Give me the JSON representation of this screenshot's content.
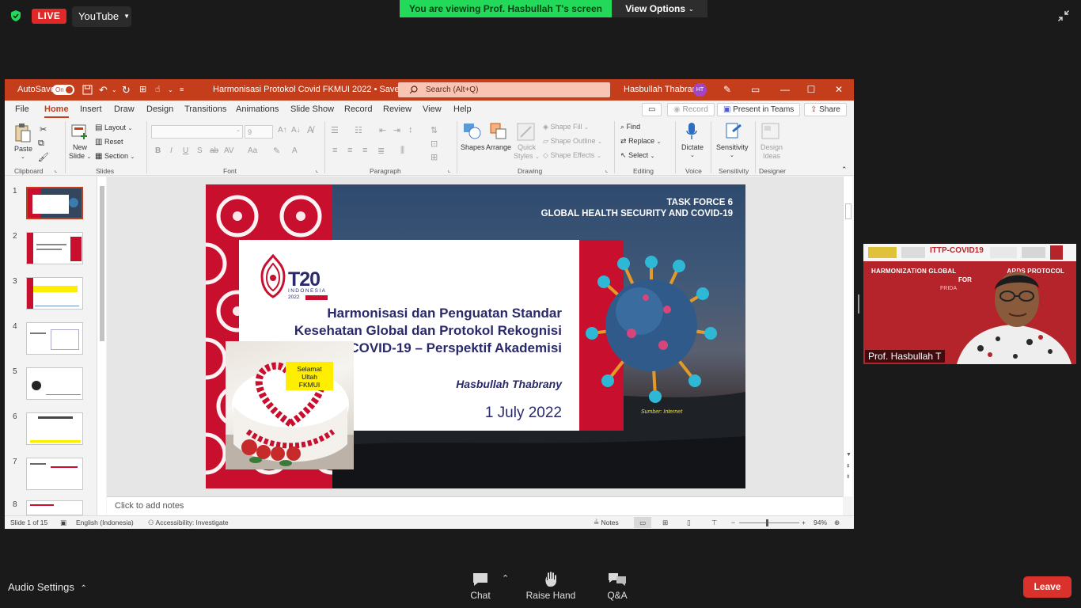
{
  "zoom": {
    "live_label": "LIVE",
    "stream_target": "YouTube",
    "viewing_banner": "You are viewing Prof. Hasbullah T's screen",
    "view_options": "View Options",
    "audio_settings": "Audio Settings",
    "chat": "Chat",
    "raise_hand": "Raise Hand",
    "qa": "Q&A",
    "leave": "Leave",
    "colors": {
      "live": "#e02828",
      "banner": "#23d959",
      "leave": "#d9322c"
    }
  },
  "ppt": {
    "autosave": "AutoSave",
    "autosave_state": "On",
    "doc_title": "Harmonisasi Protokol Covid FKMUI 2022 • Saved",
    "search_placeholder": "Search (Alt+Q)",
    "user_name": "Hasbullah Thabrany",
    "user_initials": "HT",
    "tabs": [
      "File",
      "Home",
      "Insert",
      "Draw",
      "Design",
      "Transitions",
      "Animations",
      "Slide Show",
      "Record",
      "Review",
      "View",
      "Help"
    ],
    "active_tab": "Home",
    "record_btn": "Record",
    "present_btn": "Present in Teams",
    "share_btn": "Share",
    "ribbon": {
      "paste": "Paste",
      "new_slide": "New",
      "new_slide2": "Slide",
      "layout": "Layout",
      "reset": "Reset",
      "section": "Section",
      "font_size": "9",
      "shapes": "Shapes",
      "arrange": "Arrange",
      "quick_styles": "Quick",
      "quick_styles2": "Styles",
      "shape_fill": "Shape Fill",
      "shape_outline": "Shape Outline",
      "shape_effects": "Shape Effects",
      "find": "Find",
      "replace": "Replace",
      "select": "Select",
      "dictate": "Dictate",
      "sensitivity": "Sensitivity",
      "design_ideas": "Design",
      "design_ideas2": "Ideas",
      "groups": {
        "clipboard": "Clipboard",
        "slides": "Slides",
        "font": "Font",
        "paragraph": "Paragraph",
        "drawing": "Drawing",
        "editing": "Editing",
        "voice": "Voice",
        "sensitivity": "Sensitivity",
        "designer": "Designer"
      }
    },
    "slide_numbers": [
      "1",
      "2",
      "3",
      "4",
      "5",
      "6",
      "7",
      "8"
    ],
    "notes_placeholder": "Click to add notes",
    "status": {
      "slide_count": "Slide 1 of 15",
      "language": "English (Indonesia)",
      "accessibility": "Accessibility: Investigate",
      "notes": "Notes",
      "zoom": "94%"
    },
    "colors": {
      "accent": "#c43e1c"
    }
  },
  "slide": {
    "task_force_line1": "TASK FORCE 6",
    "task_force_line2": "GLOBAL HEALTH SECURITY AND COVID-19",
    "logo_text": "T20",
    "logo_sub": "INDONESIA",
    "logo_year": "2022",
    "title_line1": "Harmonisasi dan Penguatan Standar",
    "title_line2": "Kesehatan Global dan Protokol Rekognisi",
    "title_line3": "COVID-19 – Perspektif Akademisi",
    "author": "Hasbullah Thabrany",
    "date": "1 July 2022",
    "source": "Sumber: Internet",
    "cake_note": [
      "Selamat",
      "Ultah",
      "FKMUI"
    ],
    "colors": {
      "title": "#2a2a6b",
      "red": "#c8102e"
    }
  },
  "webcam": {
    "name": "Prof. Hasbullah T",
    "banner_logo": "ITTP-COVID19",
    "bg_line1": "HARMONIZATION GLOBAL",
    "bg_line1b": "ARDS PROTOCOL",
    "bg_line2": "FOR",
    "bg_line3": "FRIDA"
  }
}
